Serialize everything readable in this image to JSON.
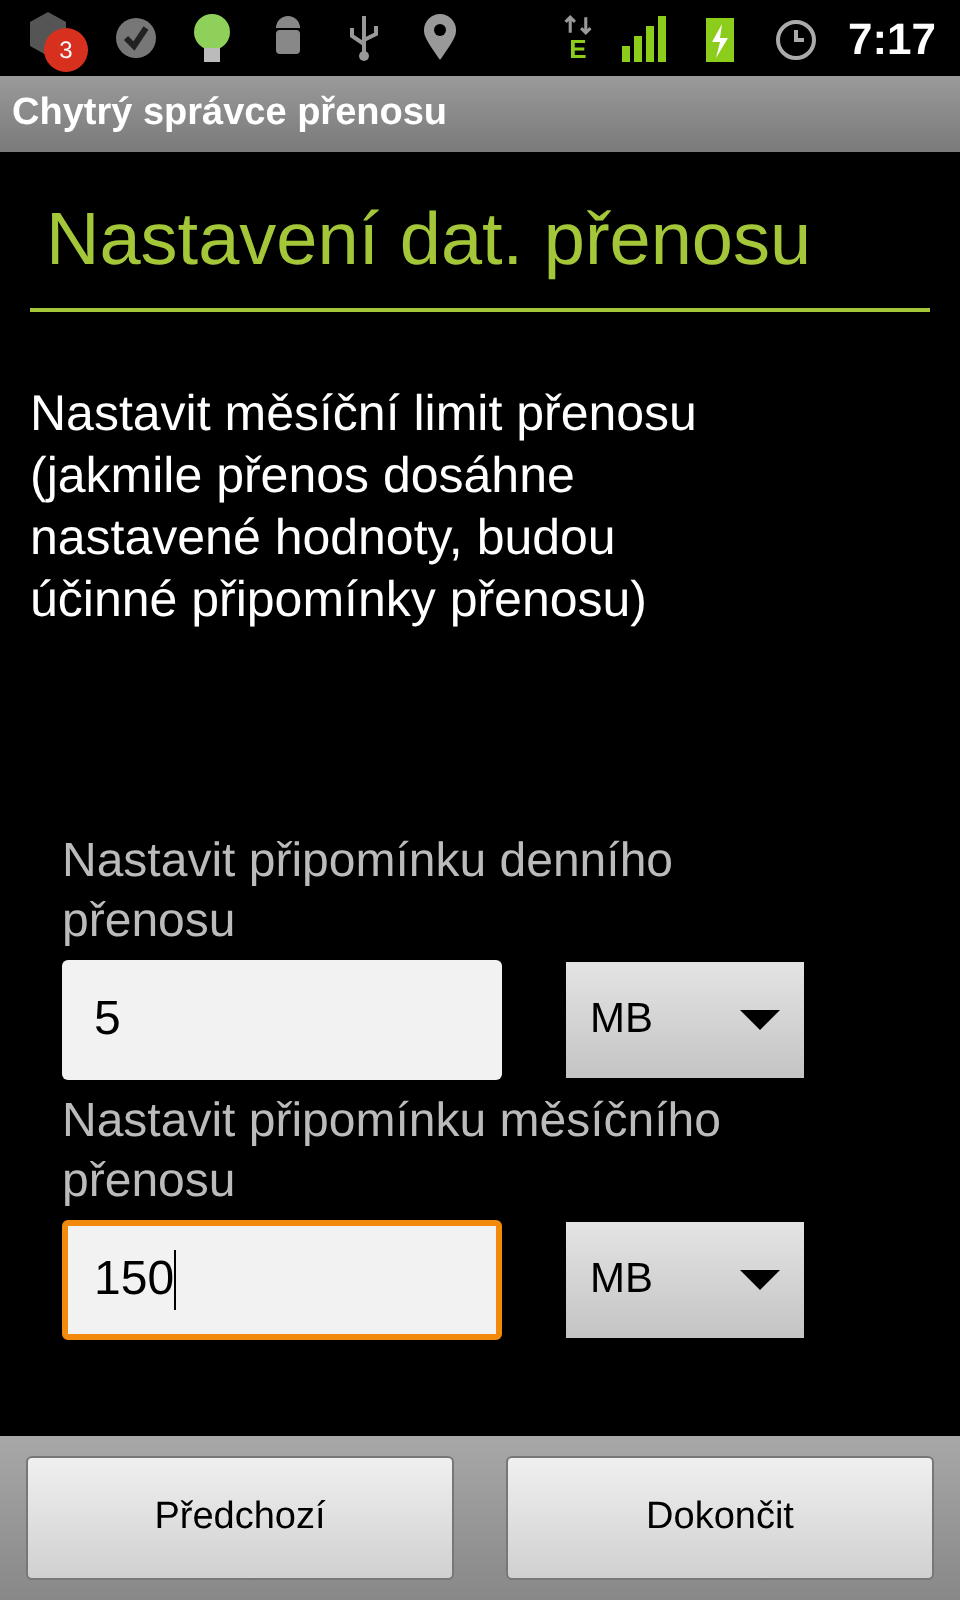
{
  "status_bar": {
    "notification_count": "3",
    "network_type": "E",
    "time": "7:17"
  },
  "title_bar": {
    "title": "Chytrý správce přenosu"
  },
  "heading": "Nastavení dat. přenosu",
  "description": "Nastavit měsíční limit přenosu (jakmile přenos dosáhne nastavené hodnoty, budou účinné připomínky přenosu)",
  "fields": [
    {
      "label": "Nastavit připomínku denního přenosu",
      "value": "5",
      "focused": false,
      "unit": "MB"
    },
    {
      "label": "Nastavit připomínku měsíčního přenosu",
      "value": "150",
      "focused": true,
      "unit": "MB"
    }
  ],
  "buttons": [
    "Předchozí",
    "Dokončit"
  ]
}
